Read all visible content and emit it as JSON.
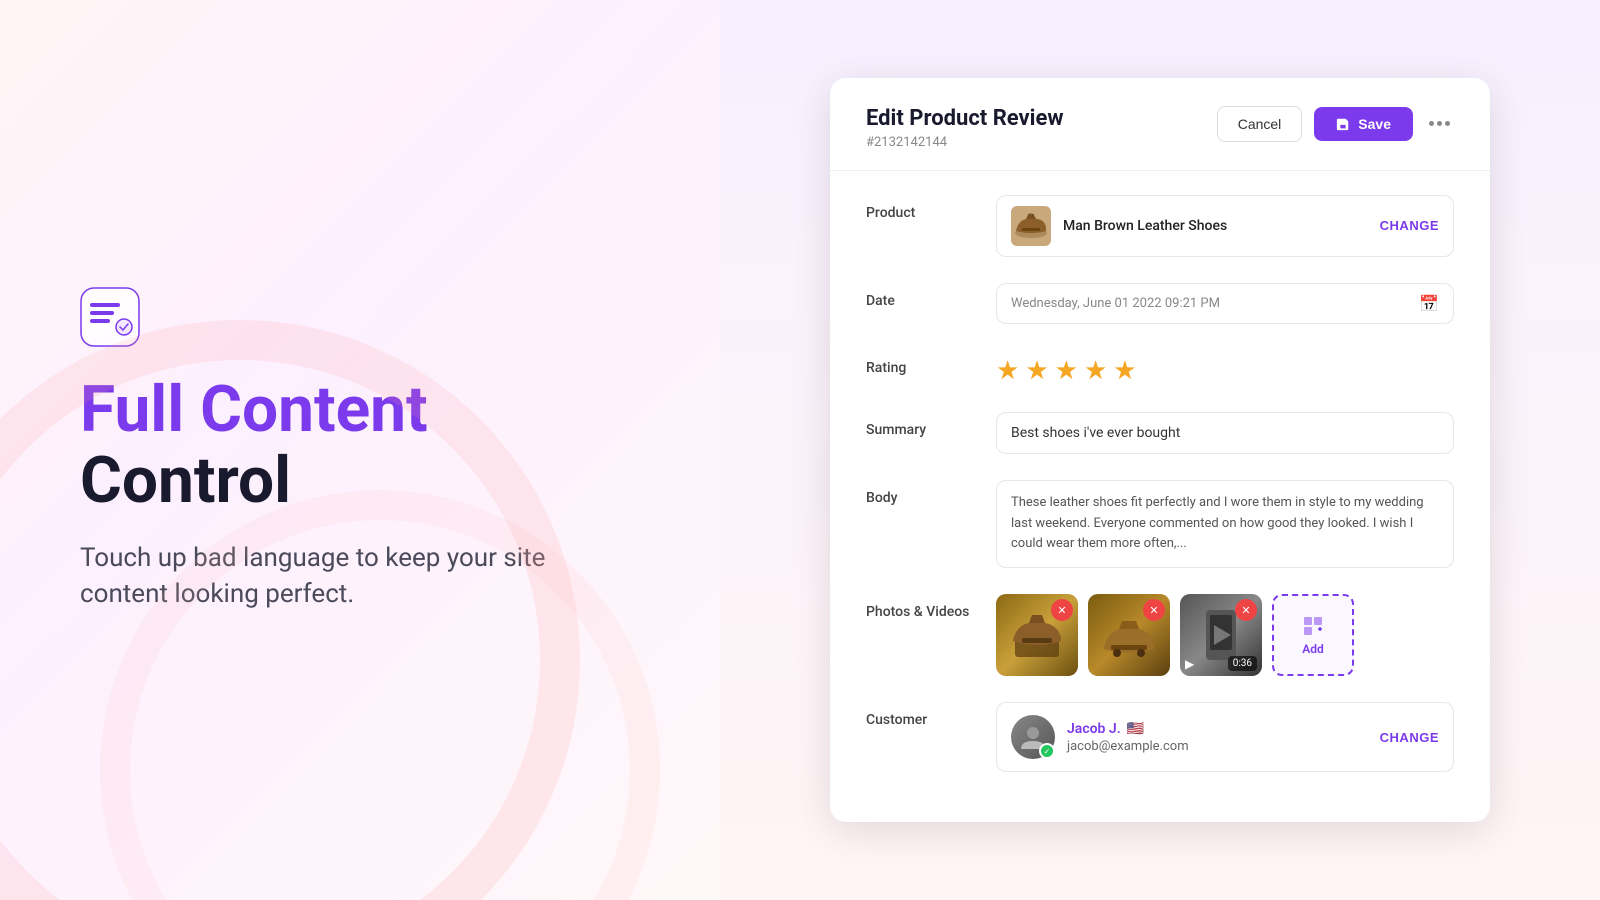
{
  "left": {
    "hero_title_line1_purple": "Full Content",
    "hero_title_line1_dark": "Control",
    "hero_subtitle": "Touch up bad language to keep your site content looking perfect."
  },
  "card": {
    "title": "Edit Product Review",
    "subtitle": "#2132142144",
    "cancel_label": "Cancel",
    "save_label": "Save",
    "fields": {
      "product": {
        "label": "Product",
        "value": "Man Brown Leather Shoes",
        "change_label": "CHANGE"
      },
      "date": {
        "label": "Date",
        "value": "Wednesday, June 01 2022 09:21 PM"
      },
      "rating": {
        "label": "Rating",
        "stars": 5
      },
      "summary": {
        "label": "Summary",
        "value": "Best shoes i've ever bought"
      },
      "body": {
        "label": "Body",
        "value": "These leather shoes fit perfectly and I wore them in style to my wedding last weekend. Everyone commented on how good they looked. I wish I could wear them more often,..."
      },
      "photos": {
        "label": "Photos & Videos",
        "add_label": "Add",
        "video_duration": "0:36"
      },
      "customer": {
        "label": "Customer",
        "name": "Jacob J.",
        "email": "jacob@example.com",
        "change_label": "CHANGE"
      }
    }
  }
}
